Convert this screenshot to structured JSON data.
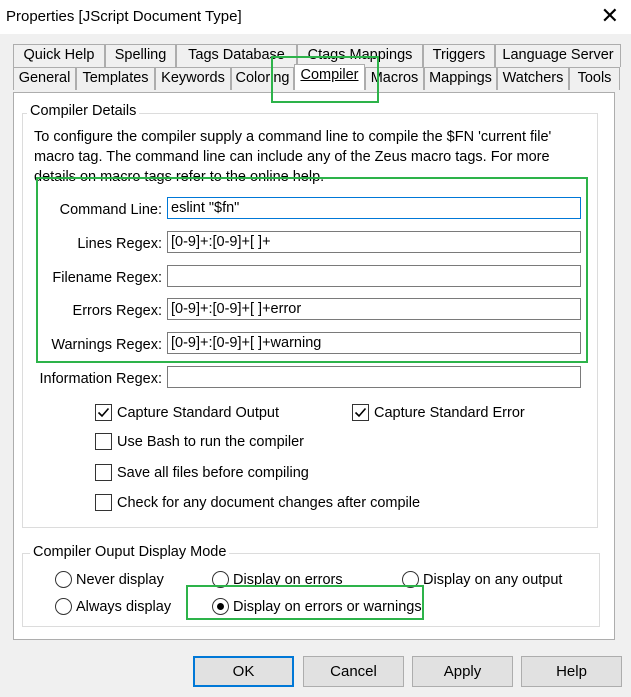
{
  "window": {
    "title": "Properties [JScript Document Type]"
  },
  "tabs_row1": [
    {
      "label": "Quick Help"
    },
    {
      "label": "Spelling"
    },
    {
      "label": "Tags Database"
    },
    {
      "label": "Ctags Mappings"
    },
    {
      "label": "Triggers"
    },
    {
      "label": "Language Server"
    }
  ],
  "tabs_row2": [
    {
      "label": "General"
    },
    {
      "label": "Templates"
    },
    {
      "label": "Keywords"
    },
    {
      "label": "Coloring"
    },
    {
      "label": "Compiler",
      "active": true
    },
    {
      "label": "Macros"
    },
    {
      "label": "Mappings"
    },
    {
      "label": "Watchers"
    },
    {
      "label": "Tools"
    }
  ],
  "compiler_details": {
    "group_label": "Compiler Details",
    "description_lines": [
      "To configure the compiler supply a command line to compile the $FN 'current file'",
      "macro tag. The command line can include any of the Zeus macro tags. For more",
      "details on macro tags refer to the online help."
    ],
    "fields": [
      {
        "label": "Command Line:",
        "value": "eslint \"$fn\""
      },
      {
        "label": "Lines Regex:",
        "value": "[0-9]+:[0-9]+[ ]+"
      },
      {
        "label": "Filename Regex:",
        "value": ""
      },
      {
        "label": "Errors Regex:",
        "value": "[0-9]+:[0-9]+[ ]+error"
      },
      {
        "label": "Warnings Regex:",
        "value": "[0-9]+:[0-9]+[ ]+warning"
      },
      {
        "label": "Information Regex:",
        "value": ""
      }
    ],
    "checkboxes": [
      {
        "label": "Capture Standard Output",
        "checked": true
      },
      {
        "label": "Capture Standard Error",
        "checked": true
      },
      {
        "label": "Use Bash to run the compiler",
        "checked": false
      },
      {
        "label": "Save all files before compiling",
        "checked": false
      },
      {
        "label": "Check for any document changes after compile",
        "checked": false
      }
    ]
  },
  "display_mode": {
    "group_label": "Compiler Ouput Display Mode",
    "options": [
      {
        "label": "Never display",
        "selected": false
      },
      {
        "label": "Display on errors",
        "selected": false
      },
      {
        "label": "Display on any output",
        "selected": false
      },
      {
        "label": "Always display",
        "selected": false
      },
      {
        "label": "Display on errors or warnings",
        "selected": true
      }
    ]
  },
  "buttons": {
    "ok": "OK",
    "cancel": "Cancel",
    "apply": "Apply",
    "help": "Help"
  },
  "colors": {
    "highlight": "#2db34a",
    "focus": "#0078d7"
  }
}
